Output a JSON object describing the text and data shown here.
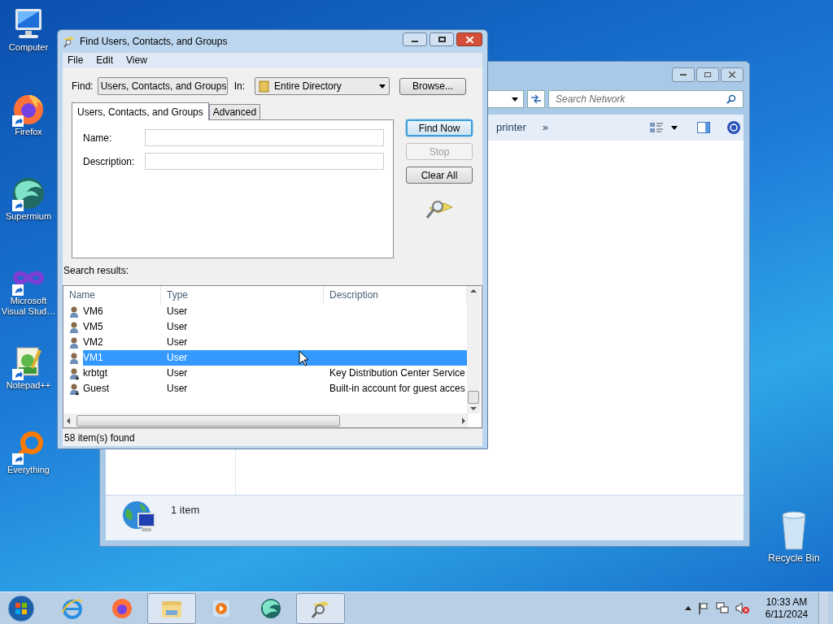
{
  "desktop_icons": [
    {
      "label": "Computer",
      "kind": "computer",
      "shortcut": false
    },
    {
      "label": "Firefox",
      "kind": "firefox",
      "shortcut": true
    },
    {
      "label": "Supermium",
      "kind": "supermium",
      "shortcut": true
    },
    {
      "label": "Microsoft Visual Stud…",
      "kind": "vs",
      "shortcut": true
    },
    {
      "label": "Notepad++",
      "kind": "notepad",
      "shortcut": true
    },
    {
      "label": "Everything",
      "kind": "everything",
      "shortcut": true
    }
  ],
  "recycle_bin": {
    "label": "Recycle Bin"
  },
  "explorer": {
    "search_placeholder": "Search Network",
    "toolbar_items": [
      "printer",
      "»"
    ],
    "status": "1 item"
  },
  "dialog": {
    "title": "Find Users, Contacts, and Groups",
    "menu": [
      "File",
      "Edit",
      "View"
    ],
    "find_label": "Find:",
    "find_value": "Users, Contacts, and Groups",
    "in_label": "In:",
    "in_value": "Entire Directory",
    "browse": "Browse...",
    "tabs": [
      {
        "label": "Users, Contacts, and Groups",
        "selected": true
      },
      {
        "label": "Advanced",
        "selected": false
      }
    ],
    "fields": [
      {
        "label": "Name:"
      },
      {
        "label": "Description:"
      }
    ],
    "buttons": [
      {
        "label": "Find Now",
        "disabled": false,
        "default": true
      },
      {
        "label": "Stop",
        "disabled": true,
        "default": false
      },
      {
        "label": "Clear All",
        "disabled": false,
        "default": false
      }
    ],
    "results_label": "Search results:",
    "columns": [
      "Name",
      "Type",
      "Description"
    ],
    "rows": [
      {
        "name": "VM6",
        "type": "User",
        "description": "",
        "selected": false,
        "kind": "user"
      },
      {
        "name": "VM5",
        "type": "User",
        "description": "",
        "selected": false,
        "kind": "user"
      },
      {
        "name": "VM2",
        "type": "User",
        "description": "",
        "selected": false,
        "kind": "user"
      },
      {
        "name": "VM1",
        "type": "User",
        "description": "",
        "selected": true,
        "kind": "user"
      },
      {
        "name": "krbtgt",
        "type": "User",
        "description": "Key Distribution Center Service",
        "selected": false,
        "kind": "disabled_user"
      },
      {
        "name": "Guest",
        "type": "User",
        "description": "Built-in account for guest acces",
        "selected": false,
        "kind": "disabled_user"
      }
    ],
    "status": "58 item(s) found"
  },
  "taskbar": {
    "apps": [
      {
        "kind": "ie",
        "open": false
      },
      {
        "kind": "firefox",
        "open": false
      },
      {
        "kind": "explorer",
        "open": true
      },
      {
        "kind": "media",
        "open": false
      },
      {
        "kind": "supermium",
        "open": false
      },
      {
        "kind": "find",
        "open": true
      }
    ],
    "time": "10:33 AM",
    "date": "6/11/2024"
  }
}
